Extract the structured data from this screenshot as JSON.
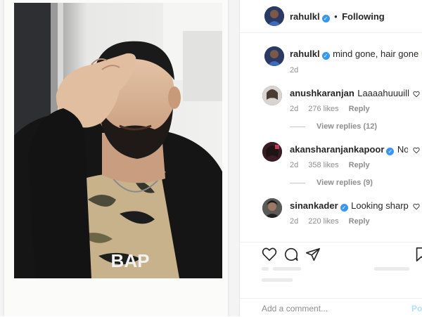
{
  "post": {
    "author": "rahulkl",
    "follow_status": "Following",
    "caption": {
      "username": "rahulkl",
      "text": "mind gone, hair gone 😳🙈",
      "time": "2d"
    },
    "photo": {
      "shirt_text": "BAP"
    }
  },
  "comments": [
    {
      "username": "anushkaranjan",
      "verified": false,
      "text": "Laaaahuuuilll",
      "time": "2d",
      "likes": "276 likes",
      "reply": "Reply",
      "view_replies": "View replies (12)"
    },
    {
      "username": "akansharanjankapoor",
      "verified": true,
      "text": "No wa",
      "time": "2d",
      "likes": "358 likes",
      "reply": "Reply",
      "view_replies": "View replies (9)"
    },
    {
      "username": "sinankader",
      "verified": true,
      "text": "Looking sharp 🔥",
      "time": "2d",
      "likes": "220 likes",
      "reply": "Reply",
      "view_replies": ""
    }
  ],
  "add_comment": {
    "placeholder": "Add a comment...",
    "post_label": "Pos"
  },
  "icons": [
    "heart-icon",
    "comment-icon",
    "share-icon",
    "bookmark-icon",
    "verified-badge-icon"
  ],
  "colors": {
    "verified": "#3897f0",
    "link_muted": "#b2dffc",
    "meta": "#8e8e8e"
  }
}
